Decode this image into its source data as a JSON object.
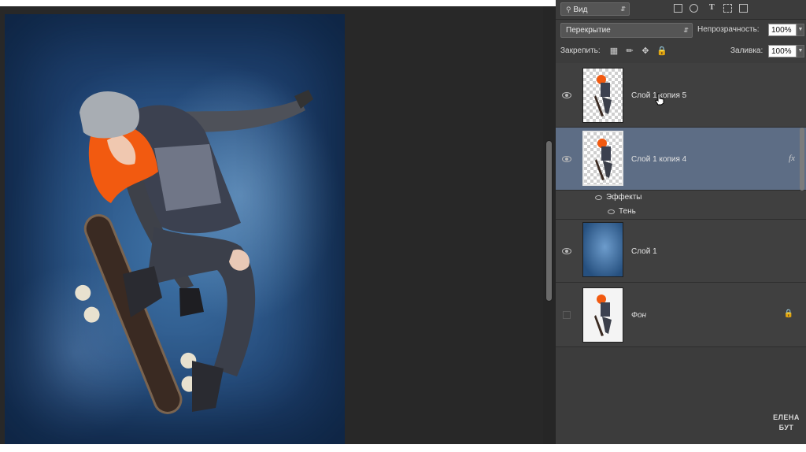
{
  "panel": {
    "filter": {
      "kind_label": "Вид",
      "search_icon": "search-icon"
    },
    "blend": {
      "mode": "Перекрытие",
      "opacity_label": "Непрозрачность:",
      "opacity_value": "100%"
    },
    "lock": {
      "label": "Закрепить:",
      "fill_label": "Заливка:",
      "fill_value": "100%"
    },
    "layers": [
      {
        "name": "Слой 1 копия 5",
        "visible": true,
        "selected": false,
        "thumb": "skater-transparent"
      },
      {
        "name": "Слой 1 копия 4",
        "visible": true,
        "selected": true,
        "thumb": "skater-transparent",
        "fx": "fx",
        "effects_label": "Эффекты",
        "effects": [
          "Тень"
        ]
      },
      {
        "name": "Слой 1",
        "visible": true,
        "selected": false,
        "thumb": "blue-texture"
      },
      {
        "name": "Фон",
        "visible": false,
        "selected": false,
        "thumb": "skater-white",
        "locked": true
      }
    ]
  },
  "watermark": {
    "line1": "ЕЛЕНА",
    "line2": "БУТ"
  },
  "colors": {
    "workspace": "#282828",
    "panel": "#3c3c3c",
    "selected_layer": "#5d6d85",
    "canvas_blue": "#2e5a8a",
    "hair_orange": "#f25a10"
  }
}
